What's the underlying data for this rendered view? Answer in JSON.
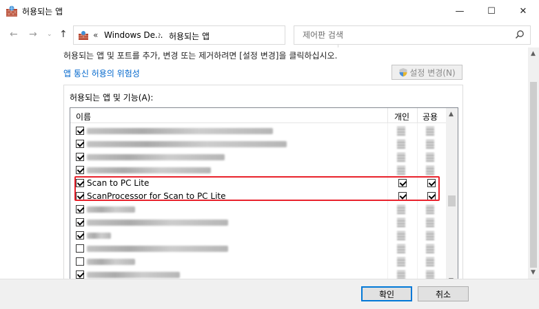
{
  "window": {
    "title": "허용되는 앱",
    "controls": {
      "minimize": "—",
      "maximize": "☐",
      "close": "✕"
    }
  },
  "address_bar": {
    "prefix": "«",
    "crumbs": [
      "Windows De...",
      "허용되는 앱"
    ],
    "separator": "›",
    "search_placeholder": "제어판 검색"
  },
  "content": {
    "instruction": "허용되는 앱 및 포트를 추가, 변경 또는 제거하려면 [설정 변경]을 클릭하십시오.",
    "risk_link": "앱 통신 허용의 위험성",
    "settings_button": "설정 변경(N)"
  },
  "group": {
    "title": "허용되는 앱 및 기능(A):",
    "columns": {
      "name": "이름",
      "private": "개인",
      "public": "공용"
    },
    "rows": [
      {
        "label": "",
        "checked": true,
        "private": true,
        "public": true,
        "blurred": true
      },
      {
        "label": "",
        "checked": true,
        "private": true,
        "public": true,
        "blurred": true
      },
      {
        "label": "",
        "checked": true,
        "private": true,
        "public": true,
        "blurred": true
      },
      {
        "label": "",
        "checked": true,
        "private": true,
        "public": true,
        "blurred": true
      },
      {
        "label": "Scan to PC Lite",
        "checked": true,
        "private": true,
        "public": true,
        "blurred": false
      },
      {
        "label": "ScanProcessor for Scan to PC Lite",
        "checked": true,
        "private": true,
        "public": true,
        "blurred": false
      },
      {
        "label": "",
        "checked": true,
        "private": true,
        "public": true,
        "blurred": true
      },
      {
        "label": "",
        "checked": true,
        "private": true,
        "public": true,
        "blurred": true
      },
      {
        "label": "",
        "checked": true,
        "private": true,
        "public": true,
        "blurred": true
      },
      {
        "label": "",
        "checked": false,
        "private": false,
        "public": false,
        "blurred": true
      },
      {
        "label": "",
        "checked": false,
        "private": false,
        "public": false,
        "blurred": true
      },
      {
        "label": "",
        "checked": true,
        "private": true,
        "public": true,
        "blurred": true
      }
    ]
  },
  "footer": {
    "ok": "확인",
    "cancel": "취소"
  },
  "colors": {
    "link": "#0066cc",
    "highlight": "#e8202a",
    "accent": "#0078d7"
  }
}
